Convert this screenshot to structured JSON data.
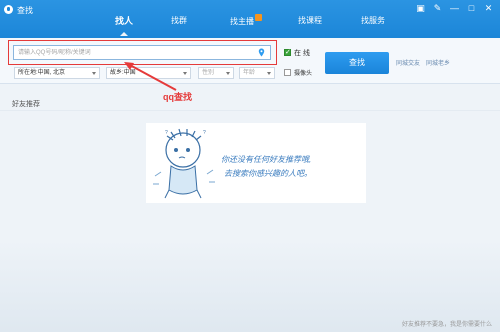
{
  "window": {
    "title": "查找"
  },
  "tabs": [
    {
      "label": "找人",
      "active": true
    },
    {
      "label": "找群",
      "active": false
    },
    {
      "label": "找主播",
      "active": false,
      "badge": true
    },
    {
      "label": "找课程",
      "active": false
    },
    {
      "label": "找服务",
      "active": false
    }
  ],
  "search": {
    "placeholder": "请输入QQ号码/昵称/关键词",
    "value": ""
  },
  "filters": {
    "location": "所在地:中国, 北京",
    "hometown": "故乡:中国",
    "gender": "性别",
    "age": "年龄"
  },
  "options": {
    "online_label": "在 线",
    "online_checked": true,
    "camera_label": "摄像头",
    "camera_checked": false
  },
  "find_button": "查找",
  "side_links": {
    "same_city": "同城交友",
    "same_hometown": "同城老乡"
  },
  "annotation": {
    "text": "qq查找",
    "color": "#e53a3a"
  },
  "section_title": "好友推荐",
  "friend_panel": {
    "line1": "你还没有任何好友推荐哦,",
    "line2": "去搜索你感兴趣的人吧。"
  },
  "footer": "好友推荐不要急，我是你需要什么",
  "colors": {
    "title_bar": "#1c86d8",
    "accent": "#2e9cf0",
    "annotation": "#e53a3a"
  },
  "icons": [
    "app-icon",
    "location-pin-icon",
    "message-icon",
    "settings-icon",
    "minimize-icon",
    "maximize-icon",
    "close-icon",
    "mascot-icon"
  ]
}
